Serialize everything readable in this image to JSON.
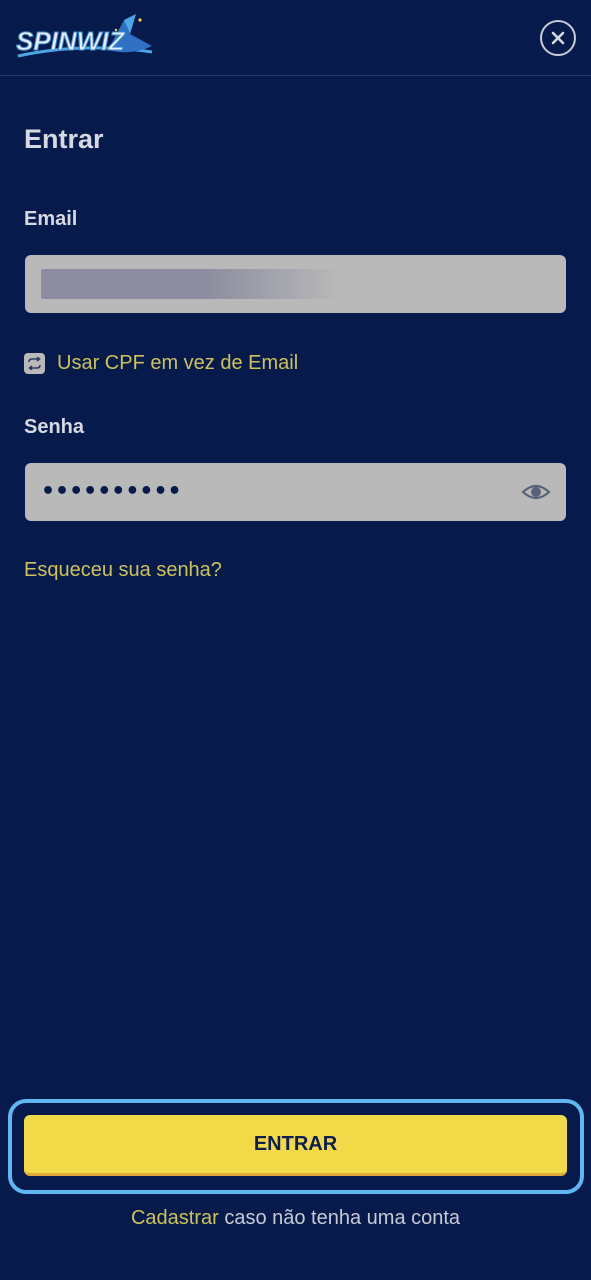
{
  "header": {
    "logo_text": "SPINWIZ",
    "close_icon": "close-icon"
  },
  "login": {
    "title": "Entrar",
    "email_label": "Email",
    "email_value": "",
    "toggle_label": "Usar CPF em vez de Email",
    "toggle_icon": "swap-icon",
    "password_label": "Senha",
    "password_value": "••••••••••",
    "password_icon": "eye-icon",
    "forgot_label": "Esqueceu sua senha?",
    "submit_label": "ENTRAR"
  },
  "footer": {
    "signup_link": "Cadastrar",
    "signup_suffix": " caso não tenha uma conta"
  },
  "colors": {
    "background": "#061a4c",
    "accent_yellow": "#f2d948",
    "link_yellow": "#cfc25a",
    "field_gray": "#b9b9b9",
    "focus_outline": "#5fb7f2"
  }
}
